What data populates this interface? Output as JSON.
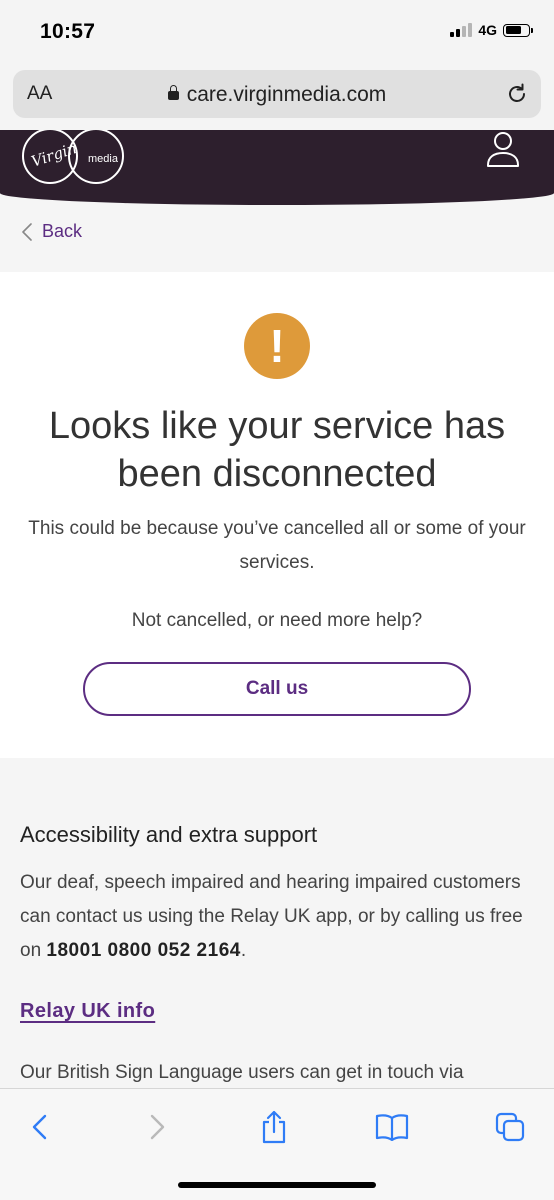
{
  "status_bar": {
    "time": "10:57",
    "network": "4G"
  },
  "browser": {
    "text_size_label": "AA",
    "url": "care.virginmedia.com"
  },
  "header": {
    "logo_script": "Virgin",
    "logo_media": "media"
  },
  "nav": {
    "back_label": "Back"
  },
  "notice": {
    "icon_glyph": "!",
    "title": "Looks like your service has been disconnected",
    "description": "This could be because you’ve cancelled all or some of your services.",
    "prompt": "Not cancelled, or need more help?",
    "call_button": "Call us"
  },
  "accessibility": {
    "heading": "Accessibility and extra support",
    "body_text": "Our deaf, speech impaired and hearing impaired customers can contact us using the Relay UK app, or by calling us free on ",
    "phone": "18001 0800 052 2164",
    "body_end": ".",
    "link_label": "Relay UK info",
    "bsl_text": "Our British Sign Language users can get in touch via"
  },
  "colors": {
    "brand_purple": "#5c2d82",
    "header_bg": "#2d1f2d",
    "warning": "#de9a3a"
  }
}
